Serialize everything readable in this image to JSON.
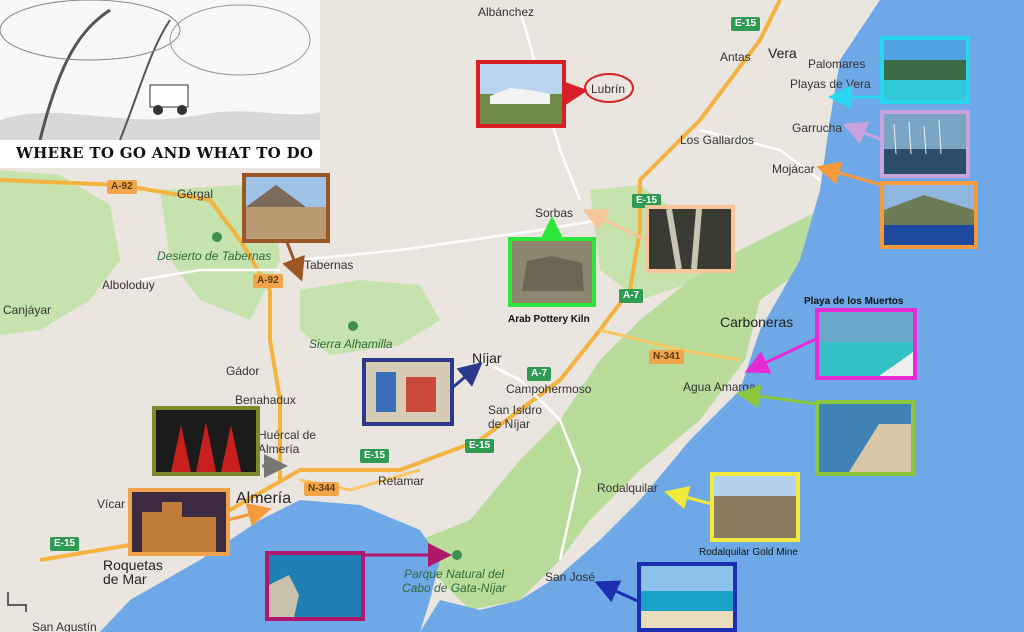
{
  "banner": {
    "title": "WHERE TO GO AND WHAT TO DO",
    "illustration": "pencil sketch of trees and an off-road vehicle"
  },
  "towns": [
    {
      "id": "albanchez",
      "name": "Albánchez"
    },
    {
      "id": "antas",
      "name": "Antas"
    },
    {
      "id": "vera",
      "name": "Vera"
    },
    {
      "id": "palomares",
      "name": "Palomares"
    },
    {
      "id": "playas-vera",
      "name": "Playas de Vera"
    },
    {
      "id": "lubrin",
      "name": "Lubrín"
    },
    {
      "id": "garrucha",
      "name": "Garrucha"
    },
    {
      "id": "los-gallardos",
      "name": "Los Gallardos"
    },
    {
      "id": "mojacar",
      "name": "Mojácar"
    },
    {
      "id": "gergal",
      "name": "Gérgal"
    },
    {
      "id": "sorbas",
      "name": "Sorbas"
    },
    {
      "id": "tabernas",
      "name": "Tabernas"
    },
    {
      "id": "alboloduy",
      "name": "Alboloduy"
    },
    {
      "id": "canjayar",
      "name": "Canjáyar"
    },
    {
      "id": "carboneras",
      "name": "Carboneras"
    },
    {
      "id": "nijar",
      "name": "Níjar"
    },
    {
      "id": "gador",
      "name": "Gádor"
    },
    {
      "id": "campohermoso",
      "name": "Campohermoso"
    },
    {
      "id": "agua-amarga",
      "name": "Agua Amarga"
    },
    {
      "id": "benahadux",
      "name": "Benahadux"
    },
    {
      "id": "san-isidro",
      "name": "San Isidro\nde Níjar"
    },
    {
      "id": "huercal",
      "name": "Huércal de\nAlmería"
    },
    {
      "id": "retamar",
      "name": "Retamar"
    },
    {
      "id": "rodalquilar",
      "name": "Rodalquilar"
    },
    {
      "id": "almeria",
      "name": "Almería"
    },
    {
      "id": "vicar",
      "name": "Vícar"
    },
    {
      "id": "roquetas",
      "name": "Roquetas\nde Mar"
    },
    {
      "id": "san-jose",
      "name": "San José"
    },
    {
      "id": "san-agustin",
      "name": "San Agustín"
    }
  ],
  "parks": [
    {
      "id": "desierto",
      "name": "Desierto de Tabernas"
    },
    {
      "id": "sierra-alhamilla",
      "name": "Sierra Alhamilla"
    },
    {
      "id": "cabo-gata",
      "name": "Parque Natural del\nCabo de Gata-Níjar"
    }
  ],
  "road_shields": [
    {
      "id": "e15-ne",
      "label": "E-15",
      "color": "green"
    },
    {
      "id": "a92-w",
      "label": "A-92",
      "color": "orange"
    },
    {
      "id": "a92-tab",
      "label": "A-92",
      "color": "orange"
    },
    {
      "id": "e15-sorbas",
      "label": "E-15",
      "color": "green"
    },
    {
      "id": "a7-n",
      "label": "A-7",
      "color": "green"
    },
    {
      "id": "n341",
      "label": "N-341",
      "color": "orange"
    },
    {
      "id": "a7-nijar",
      "label": "A-7",
      "color": "green"
    },
    {
      "id": "e15-nijar",
      "label": "E-15",
      "color": "green"
    },
    {
      "id": "e15-alm",
      "label": "E-15",
      "color": "green"
    },
    {
      "id": "n344",
      "label": "N-344",
      "color": "orange"
    },
    {
      "id": "e15-w",
      "label": "E-15",
      "color": "green"
    }
  ],
  "photos": [
    {
      "id": "lubrin",
      "subject": "hilltop white village",
      "border": "#d81f26"
    },
    {
      "id": "playas-vera",
      "subject": "waterpark pool",
      "border": "#27d7f0"
    },
    {
      "id": "garrucha",
      "subject": "marina with boats",
      "border": "#c9a2de"
    },
    {
      "id": "mojacar",
      "subject": "hillside white town by the sea",
      "border": "#f39a3c"
    },
    {
      "id": "sorbas-caves",
      "subject": "gypsum caves",
      "border": "#f7c59a"
    },
    {
      "id": "pottery",
      "subject": "stone kiln ruin",
      "border": "#2ee63a"
    },
    {
      "id": "tabernas",
      "subject": "western film set",
      "border": "#9c5526"
    },
    {
      "id": "muertos",
      "subject": "turquoise beach cove",
      "border": "#e62bd6"
    },
    {
      "id": "agua-amarga",
      "subject": "bay and village",
      "border": "#8cc63e"
    },
    {
      "id": "rodalquilar",
      "subject": "old gold mine",
      "border": "#f1ea3c"
    },
    {
      "id": "san-jose",
      "subject": "sandy beach",
      "border": "#1d2fb0"
    },
    {
      "id": "nijar",
      "subject": "market stalls",
      "border": "#2c3a8e"
    },
    {
      "id": "flamenco",
      "subject": "flamenco dancers in red",
      "border": "#7b8a2a"
    },
    {
      "id": "alcazaba",
      "subject": "Alcazaba fortress at night",
      "border": "#f0a34a"
    },
    {
      "id": "cabo-gata",
      "subject": "rocky sea coast",
      "border": "#b0186e"
    }
  ],
  "captions": {
    "pottery": "Arab Pottery Kiln",
    "muertos": "Playa de los Muertos",
    "rodalquilar": "Rodalquilar Gold Mine"
  },
  "colors": {
    "sea": "#6ea8e6",
    "land": "#eae6df",
    "green_area": "#bfdfa2",
    "motorway": "#f4b33f",
    "road": "#ffffff"
  }
}
